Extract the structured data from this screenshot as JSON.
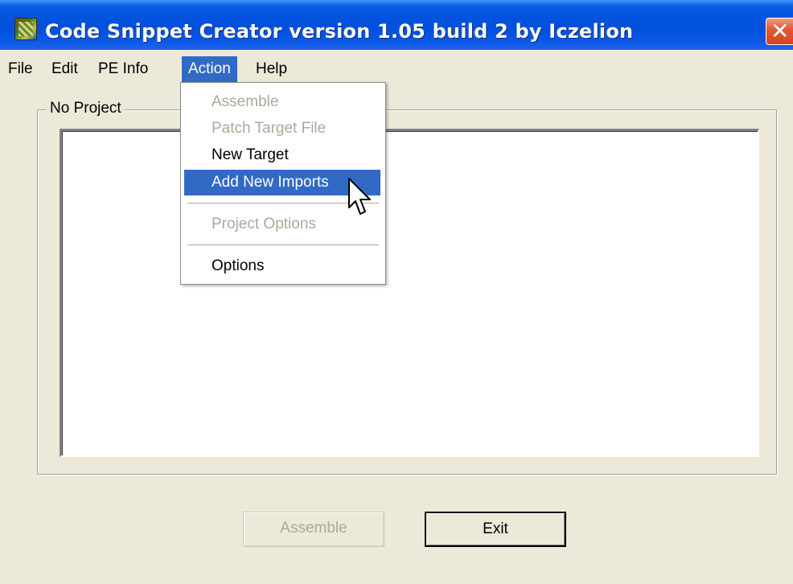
{
  "window": {
    "title": "Code Snippet Creator version 1.05 build 2 by Iczelion",
    "close_glyph": "✕"
  },
  "menubar": {
    "items": [
      {
        "label": "File"
      },
      {
        "label": "Edit"
      },
      {
        "label": "PE Info"
      },
      {
        "label": "Action",
        "active": true
      },
      {
        "label": "Help"
      }
    ]
  },
  "action_menu": {
    "items": [
      {
        "label": "Assemble",
        "enabled": false
      },
      {
        "label": "Patch Target File",
        "enabled": false
      },
      {
        "label": "New Target",
        "enabled": true
      },
      {
        "label": "Add New Imports",
        "enabled": true,
        "highlighted": true
      },
      {
        "label": "Project Options",
        "enabled": false
      },
      {
        "label": "Options",
        "enabled": true
      }
    ]
  },
  "project": {
    "group_label": "No Project",
    "editor_text": ""
  },
  "buttons": {
    "assemble_label": "Assemble",
    "exit_label": "Exit"
  },
  "colors": {
    "titlebar": "#0454e0",
    "highlight": "#316ac5",
    "window_bg": "#ece9d8",
    "disabled_text": "#aca899"
  },
  "icons": {
    "app": "app-icon",
    "close": "close-icon",
    "cursor": "mouse-pointer-icon"
  }
}
